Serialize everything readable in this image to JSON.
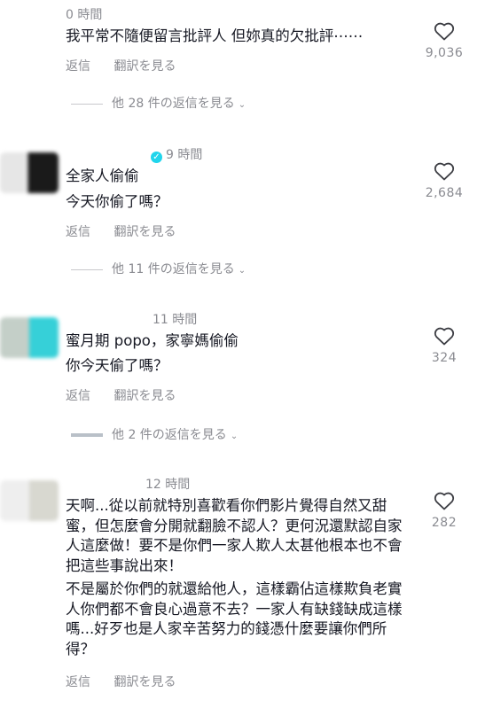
{
  "comments": [
    {
      "time": "0 時間",
      "lines": [
        "我平常不隨便留言批評人 但妳真的欠批評⋯⋯"
      ],
      "reply_label": "返信",
      "translate_label": "翻訳を見る",
      "likes": "9,036",
      "more_replies": "他 28 件の返信を見る"
    },
    {
      "time": "9 時間",
      "lines": [
        "全家人偷偷",
        "今天你偷了嗎？"
      ],
      "reply_label": "返信",
      "translate_label": "翻訳を見る",
      "likes": "2,684",
      "more_replies": "他 11 件の返信を見る"
    },
    {
      "time": "11 時間",
      "lines": [
        "蜜月期 popo，家寧媽偷偷",
        "你今天偷了嗎？"
      ],
      "reply_label": "返信",
      "translate_label": "翻訳を見る",
      "likes": "324",
      "more_replies": "他 2 件の返信を見る"
    },
    {
      "time": "12 時間",
      "paragraphs": [
        "天啊...從以前就特別喜歡看你們影片覺得自然又甜蜜，但怎麼會分開就翻臉不認人？更何況還默認自家人這麼做！要不是你們一家人欺人太甚他根本也不會把這些事說出來！",
        "不是屬於你們的就還給他人，這樣霸佔這樣欺負老實人你們都不會良心過意不去？一家人有缺錢缺成這樣嗎...好歹也是人家辛苦努力的錢憑什麼要讓你們所得？"
      ],
      "reply_label": "返信",
      "translate_label": "翻訳を見る",
      "likes": "282"
    }
  ],
  "colors": {
    "text": "#161823",
    "secondary": "#8a8b91",
    "verified": "#20d5ec"
  },
  "icons": {
    "like": "heart-outline-icon",
    "verified": "verified-badge-icon"
  }
}
